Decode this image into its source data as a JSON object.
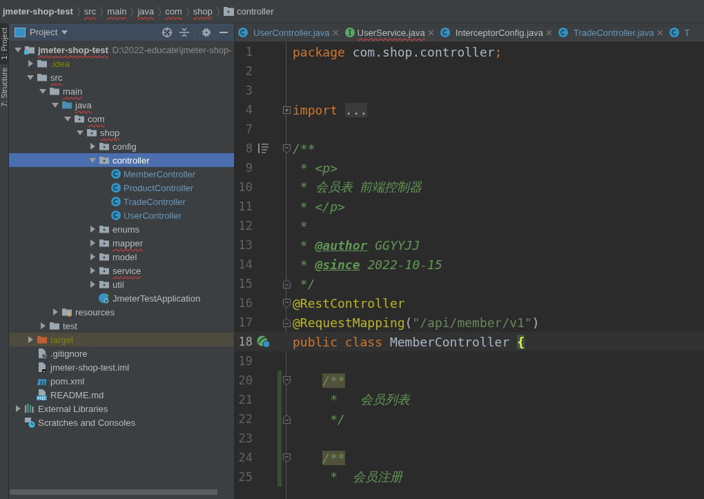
{
  "breadcrumb": [
    {
      "label": "jmeter-shop-test",
      "kind": "project",
      "misspelled": false
    },
    {
      "label": "src",
      "kind": "dir",
      "misspelled": true
    },
    {
      "label": "main",
      "kind": "dir",
      "misspelled": true
    },
    {
      "label": "java",
      "kind": "dir",
      "misspelled": true
    },
    {
      "label": "com",
      "kind": "dir",
      "misspelled": true
    },
    {
      "label": "shop",
      "kind": "dir",
      "misspelled": true
    },
    {
      "label": "controller",
      "kind": "package",
      "misspelled": false
    }
  ],
  "tool_strip": [
    {
      "label": "1: Project",
      "selected": true
    },
    {
      "label": "7: Structure",
      "selected": false
    }
  ],
  "project_panel": {
    "title": "Project",
    "tree": [
      {
        "label": "jmeter-shop-test",
        "hint": "D:\\2022-educate\\jmeter-shop-",
        "kind": "module",
        "color": "#bbbbbb",
        "excluded": false,
        "misspelled": true,
        "selected": false,
        "expanded": true,
        "children": [
          {
            "label": ".idea",
            "kind": "folder",
            "color": "#848504",
            "excluded": false,
            "misspelled": false,
            "selected": false,
            "expanded": false
          },
          {
            "label": "src",
            "kind": "folder",
            "color": "#bbbbbb",
            "excluded": false,
            "misspelled": true,
            "selected": false,
            "expanded": true,
            "children": [
              {
                "label": "main",
                "kind": "folder",
                "color": "#bbbbbb",
                "excluded": false,
                "misspelled": true,
                "selected": false,
                "expanded": true,
                "children": [
                  {
                    "label": "java",
                    "kind": "source-folder",
                    "color": "#bbbbbb",
                    "excluded": false,
                    "misspelled": true,
                    "selected": false,
                    "expanded": true,
                    "children": [
                      {
                        "label": "com",
                        "kind": "package",
                        "color": "#bbbbbb",
                        "excluded": false,
                        "misspelled": true,
                        "selected": false,
                        "expanded": true,
                        "children": [
                          {
                            "label": "shop",
                            "kind": "package",
                            "color": "#bbbbbb",
                            "excluded": false,
                            "misspelled": true,
                            "selected": false,
                            "expanded": true,
                            "children": [
                              {
                                "label": "config",
                                "kind": "package",
                                "color": "#bbbbbb",
                                "excluded": false,
                                "misspelled": false,
                                "selected": false,
                                "expanded": false
                              },
                              {
                                "label": "controller",
                                "kind": "package",
                                "color": "#ffffff",
                                "excluded": false,
                                "misspelled": false,
                                "selected": true,
                                "expanded": true,
                                "children": [
                                  {
                                    "label": "MemberController",
                                    "kind": "class",
                                    "color": "#6897bb",
                                    "excluded": false,
                                    "misspelled": false,
                                    "selected": false
                                  },
                                  {
                                    "label": "ProductController",
                                    "kind": "class",
                                    "color": "#6897bb",
                                    "excluded": false,
                                    "misspelled": false,
                                    "selected": false
                                  },
                                  {
                                    "label": "TradeController",
                                    "kind": "class",
                                    "color": "#6897bb",
                                    "excluded": false,
                                    "misspelled": false,
                                    "selected": false
                                  },
                                  {
                                    "label": "UserController",
                                    "kind": "class",
                                    "color": "#6897bb",
                                    "excluded": false,
                                    "misspelled": false,
                                    "selected": false
                                  }
                                ]
                              },
                              {
                                "label": "enums",
                                "kind": "package",
                                "color": "#bbbbbb",
                                "excluded": false,
                                "misspelled": false,
                                "selected": false,
                                "expanded": false
                              },
                              {
                                "label": "mapper",
                                "kind": "package",
                                "color": "#bbbbbb",
                                "excluded": false,
                                "misspelled": true,
                                "selected": false,
                                "expanded": false
                              },
                              {
                                "label": "model",
                                "kind": "package",
                                "color": "#bbbbbb",
                                "excluded": false,
                                "misspelled": false,
                                "selected": false,
                                "expanded": false
                              },
                              {
                                "label": "service",
                                "kind": "package",
                                "color": "#bbbbbb",
                                "excluded": false,
                                "misspelled": true,
                                "selected": false,
                                "expanded": false
                              },
                              {
                                "label": "util",
                                "kind": "package",
                                "color": "#bbbbbb",
                                "excluded": false,
                                "misspelled": false,
                                "selected": false,
                                "expanded": false
                              },
                              {
                                "label": "JmeterTestApplication",
                                "kind": "spring-class",
                                "color": "#bbbbbb",
                                "excluded": false,
                                "misspelled": false,
                                "selected": false
                              }
                            ]
                          }
                        ]
                      }
                    ]
                  },
                  {
                    "label": "resources",
                    "kind": "resources-folder",
                    "color": "#bbbbbb",
                    "excluded": false,
                    "misspelled": false,
                    "selected": false,
                    "expanded": false
                  }
                ]
              },
              {
                "label": "test",
                "kind": "folder",
                "color": "#bbbbbb",
                "excluded": false,
                "misspelled": false,
                "selected": false,
                "expanded": false
              }
            ]
          },
          {
            "label": "target",
            "kind": "excluded-folder",
            "color": "#848504",
            "excluded": true,
            "misspelled": false,
            "selected": false,
            "expanded": false
          },
          {
            "label": ".gitignore",
            "kind": "ignore-file",
            "color": "#bbbbbb",
            "excluded": false,
            "misspelled": false,
            "selected": false
          },
          {
            "label": "jmeter-shop-test.iml",
            "kind": "iml-file",
            "color": "#bbbbbb",
            "excluded": false,
            "misspelled": false,
            "selected": false
          },
          {
            "label": "pom.xml",
            "kind": "maven",
            "color": "#bbbbbb",
            "excluded": false,
            "misspelled": false,
            "selected": false
          },
          {
            "label": "README.md",
            "kind": "markdown",
            "color": "#bbbbbb",
            "excluded": false,
            "misspelled": false,
            "selected": false
          }
        ]
      },
      {
        "label": "External Libraries",
        "kind": "libraries",
        "color": "#bbbbbb",
        "excluded": false,
        "misspelled": false,
        "selected": false,
        "expanded": false
      },
      {
        "label": "Scratches and Consoles",
        "kind": "scratches",
        "color": "#bbbbbb",
        "excluded": false,
        "misspelled": false,
        "selected": false
      }
    ]
  },
  "editor_tabs": [
    {
      "label": "UserController.java",
      "kind": "class",
      "modified": true,
      "misspelled": false,
      "selected": false,
      "closable": true
    },
    {
      "label": "UserService.java",
      "kind": "interface",
      "modified": false,
      "misspelled": true,
      "selected": false,
      "closable": true
    },
    {
      "label": "InterceptorConfig.java",
      "kind": "class",
      "modified": false,
      "misspelled": false,
      "selected": false,
      "closable": true
    },
    {
      "label": "TradeController.java",
      "kind": "class",
      "modified": true,
      "misspelled": false,
      "selected": false,
      "closable": true
    },
    {
      "label": "T",
      "kind": "class",
      "modified": true,
      "misspelled": false,
      "selected": false,
      "closable": false
    }
  ],
  "code": [
    {
      "number": "1",
      "current": false,
      "changed": false,
      "tokens": [
        {
          "text": "package",
          "kind": "keyword"
        },
        {
          "text": " com.shop.controller",
          "kind": "plain"
        },
        {
          "text": ";",
          "kind": "keyword"
        }
      ]
    },
    {
      "number": "2",
      "current": false,
      "changed": false
    },
    {
      "number": "3",
      "current": false,
      "changed": false
    },
    {
      "number": "4",
      "current": false,
      "changed": false,
      "fold": {
        "kind": "collapsed"
      },
      "tokens": [
        {
          "text": "import ",
          "kind": "keyword"
        },
        {
          "text": "...",
          "kind": "folded"
        }
      ]
    },
    {
      "number": "7",
      "current": false,
      "changed": false
    },
    {
      "number": "8",
      "current": false,
      "changed": false,
      "gutter": {
        "kind": "doc"
      },
      "fold": {
        "kind": "start"
      },
      "tokens": [
        {
          "text": "/**",
          "kind": "comment"
        }
      ]
    },
    {
      "number": "9",
      "current": false,
      "changed": false,
      "tokens": [
        {
          "text": " * <p>",
          "kind": "comment"
        }
      ]
    },
    {
      "number": "10",
      "current": false,
      "changed": false,
      "tokens": [
        {
          "text": " * 会员表 前端控制器",
          "kind": "comment"
        }
      ]
    },
    {
      "number": "11",
      "current": false,
      "changed": false,
      "tokens": [
        {
          "text": " * </p>",
          "kind": "comment"
        }
      ]
    },
    {
      "number": "12",
      "current": false,
      "changed": false,
      "tokens": [
        {
          "text": " *",
          "kind": "comment"
        }
      ]
    },
    {
      "number": "13",
      "current": false,
      "changed": false,
      "tokens": [
        {
          "text": " * ",
          "kind": "comment"
        },
        {
          "text": "@author",
          "kind": "doc-tag"
        },
        {
          "text": " GGYYJJ",
          "kind": "comment"
        }
      ]
    },
    {
      "number": "14",
      "current": false,
      "changed": false,
      "tokens": [
        {
          "text": " * ",
          "kind": "comment"
        },
        {
          "text": "@since",
          "kind": "doc-tag"
        },
        {
          "text": " 2022-10-15",
          "kind": "comment"
        }
      ]
    },
    {
      "number": "15",
      "current": false,
      "changed": false,
      "fold": {
        "kind": "end"
      },
      "tokens": [
        {
          "text": " */",
          "kind": "comment"
        }
      ]
    },
    {
      "number": "16",
      "current": false,
      "changed": false,
      "fold": {
        "kind": "start"
      },
      "tokens": [
        {
          "text": "@RestController",
          "kind": "annotation"
        }
      ]
    },
    {
      "number": "17",
      "current": false,
      "changed": false,
      "fold": {
        "kind": "end"
      },
      "tokens": [
        {
          "text": "@RequestMapping",
          "kind": "annotation"
        },
        {
          "text": "(",
          "kind": "plain"
        },
        {
          "text": "\"/api/member/v1\"",
          "kind": "string"
        },
        {
          "text": ")",
          "kind": "plain"
        }
      ]
    },
    {
      "number": "18",
      "current": true,
      "changed": false,
      "gutter": {
        "kind": "bean"
      },
      "tokens": [
        {
          "text": "public ",
          "kind": "keyword"
        },
        {
          "text": "class",
          "kind": "keyword"
        },
        {
          "text": " MemberController ",
          "kind": "plain"
        },
        {
          "text": "{",
          "kind": "brace-match"
        }
      ]
    },
    {
      "number": "19",
      "current": false,
      "changed": false
    },
    {
      "number": "20",
      "current": false,
      "changed": true,
      "fold": {
        "kind": "start"
      },
      "tokens": [
        {
          "text": "    /**",
          "kind": "comment-marked"
        }
      ]
    },
    {
      "number": "21",
      "current": false,
      "changed": true,
      "tokens": [
        {
          "text": "     *   会员列表",
          "kind": "comment"
        }
      ]
    },
    {
      "number": "22",
      "current": false,
      "changed": true,
      "fold": {
        "kind": "end"
      },
      "tokens": [
        {
          "text": "     */",
          "kind": "comment"
        }
      ]
    },
    {
      "number": "23",
      "current": false,
      "changed": true
    },
    {
      "number": "24",
      "current": false,
      "changed": true,
      "fold": {
        "kind": "start"
      },
      "tokens": [
        {
          "text": "    /**",
          "kind": "comment-marked"
        }
      ]
    },
    {
      "number": "25",
      "current": false,
      "changed": true,
      "tokens": [
        {
          "text": "     *  会员注册",
          "kind": "comment"
        }
      ]
    }
  ]
}
